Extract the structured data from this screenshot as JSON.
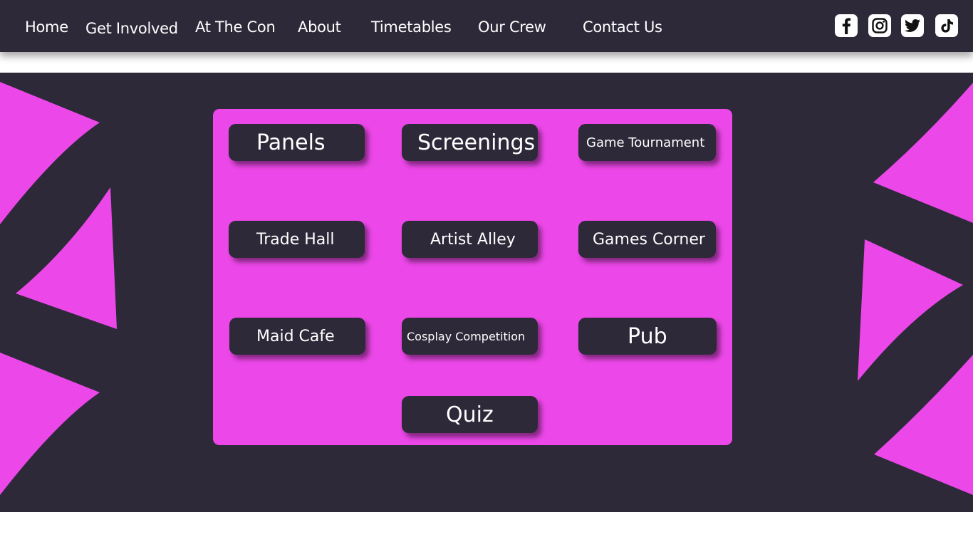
{
  "nav": {
    "links": [
      "Home",
      "Get Involved",
      "At The Con",
      "About",
      "Timetables",
      "Our Crew",
      "Contact Us"
    ],
    "social": [
      "facebook-icon",
      "instagram-icon",
      "twitter-icon",
      "tiktok-icon"
    ]
  },
  "events": {
    "buttons": [
      "Panels",
      "Screenings",
      "Game Tournament",
      "Trade Hall",
      "Artist Alley",
      "Games Corner",
      "Maid Cafe",
      "Cosplay Competition",
      "Pub",
      "Quiz"
    ]
  },
  "colors": {
    "dark": "#2d2939",
    "accent": "#ec47e8",
    "white": "#ffffff"
  }
}
